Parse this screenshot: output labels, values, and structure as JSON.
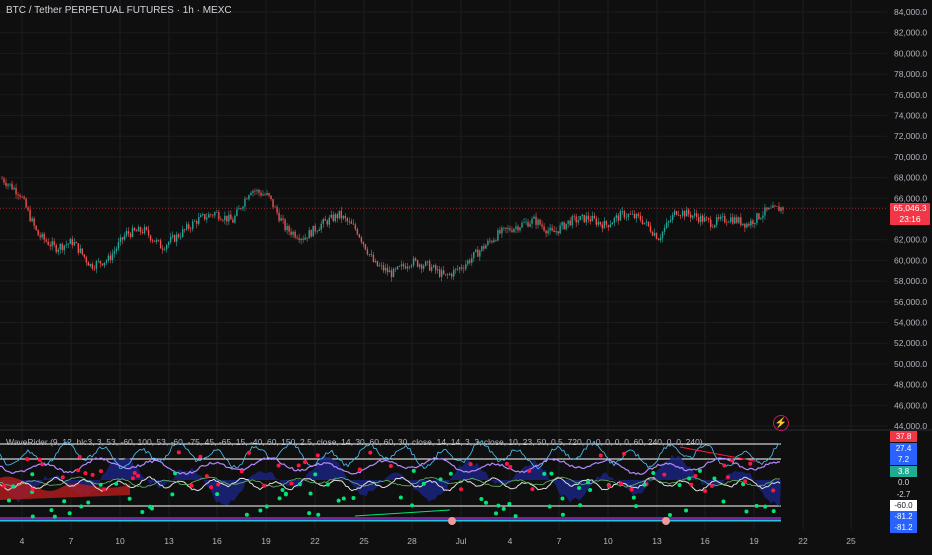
{
  "header": {
    "title": "BTC / Tether PERPETUAL FUTURES · 1h · MEXC"
  },
  "indicator": {
    "title": "WaveRider (9, 12, hlc3, 3, 53, -60, 100, 53, -60, -75, 45, -65, 15, -40, 60, 150, 2.5, close, 14, 30, 60, 60, 30, close, 14, 14, 3, 3, close, 10, 23, 50, 0.5, 720, 0, 0, 0, 0, 0, 60, 240, 0, 0, 240)",
    "scale_labels": [
      {
        "text": "37.8",
        "bg": "#f23645",
        "fg": "#ffffff"
      },
      {
        "text": "27.4",
        "bg": "#2962ff",
        "fg": "#ffffff"
      },
      {
        "text": "7.2",
        "bg": "#2962ff",
        "fg": "#ffffff"
      },
      {
        "text": "3.8",
        "bg": "#22ab94",
        "fg": "#ffffff"
      },
      {
        "text": "0.0",
        "bg": "#0f0f0f",
        "fg": "#d1d4dc"
      },
      {
        "text": "-2.7",
        "bg": "#0f0f0f",
        "fg": "#d1d4dc"
      },
      {
        "text": "-60.0",
        "bg": "#ffffff",
        "fg": "#131722"
      },
      {
        "text": "-81.2",
        "bg": "#2962ff",
        "fg": "#ffffff"
      },
      {
        "text": "-81.2",
        "bg": "#2962ff",
        "fg": "#ffffff"
      }
    ]
  },
  "price_tag": {
    "price": "65,046.3",
    "countdown": "23:16"
  },
  "bolt_icon": "lightning-icon",
  "colors": {
    "up": "#26a69a",
    "down": "#ef5350",
    "background": "#0f0f0f",
    "grid": "#1c1c1c",
    "price_line": "#f23645",
    "wave_blue": "#2962ff",
    "wave_purple": "#b388ff",
    "wave_green": "#00e676",
    "wave_red": "#ff1744",
    "wave_white": "#e0e0e0"
  },
  "chart_data": {
    "type": "candlestick",
    "title": "BTC / Tether PERPETUAL FUTURES · 1h · MEXC",
    "y_ticks": [
      "84,000.0",
      "82,000.0",
      "80,000.0",
      "78,000.0",
      "76,000.0",
      "74,000.0",
      "72,000.0",
      "70,000.0",
      "68,000.0",
      "66,000.0",
      "62,000.0",
      "60,000.0",
      "58,000.0",
      "56,000.0",
      "54,000.0",
      "52,000.0",
      "50,000.0",
      "48,000.0",
      "46,000.0",
      "44,000.0"
    ],
    "ylim": [
      43000,
      85500
    ],
    "x_ticks": [
      "4",
      "7",
      "10",
      "13",
      "16",
      "19",
      "22",
      "25",
      "28",
      "Jul",
      "4",
      "7",
      "10",
      "13",
      "16",
      "19",
      "22",
      "25"
    ],
    "last_price": 65046.3,
    "price_path": [
      [
        0,
        67900
      ],
      [
        2,
        66500
      ],
      [
        4,
        62500
      ],
      [
        6,
        61200
      ],
      [
        8,
        61800
      ],
      [
        10,
        59500
      ],
      [
        12,
        60100
      ],
      [
        14,
        62600
      ],
      [
        16,
        62900
      ],
      [
        18,
        61300
      ],
      [
        20,
        62500
      ],
      [
        22,
        63900
      ],
      [
        24,
        64600
      ],
      [
        26,
        63800
      ],
      [
        28,
        66900
      ],
      [
        30,
        66200
      ],
      [
        32,
        63000
      ],
      [
        34,
        62200
      ],
      [
        36,
        63500
      ],
      [
        38,
        64400
      ],
      [
        40,
        62900
      ],
      [
        42,
        59600
      ],
      [
        44,
        58700
      ],
      [
        46,
        59900
      ],
      [
        48,
        59500
      ],
      [
        50,
        58400
      ],
      [
        52,
        59500
      ],
      [
        54,
        61100
      ],
      [
        56,
        62600
      ],
      [
        58,
        63300
      ],
      [
        60,
        63900
      ],
      [
        62,
        62600
      ],
      [
        64,
        63800
      ],
      [
        66,
        64100
      ],
      [
        68,
        63400
      ],
      [
        70,
        64500
      ],
      [
        72,
        64000
      ],
      [
        74,
        62200
      ],
      [
        76,
        64800
      ],
      [
        78,
        64300
      ],
      [
        80,
        63600
      ],
      [
        82,
        64100
      ],
      [
        84,
        63500
      ],
      [
        86,
        64700
      ],
      [
        88,
        65100
      ]
    ]
  }
}
